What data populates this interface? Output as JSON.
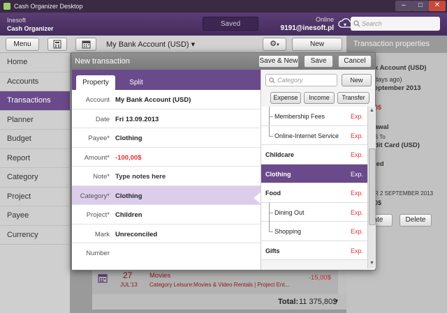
{
  "window": {
    "title": "Cash Organizer Desktop",
    "minimize": "–",
    "maximize": "□",
    "close": "✕"
  },
  "header": {
    "brand_company": "Inesoft",
    "brand_product": "Cash Organizer",
    "sync_status": "Saved",
    "online_label": "Online",
    "user_email": "9191@inesoft.pl",
    "search_placeholder": "Search"
  },
  "toolbar": {
    "menu_label": "Menu",
    "account_name": "My Bank Account (USD)",
    "new_transaction_label": "New transaction",
    "panel_title": "Transaction properties"
  },
  "sidebar": {
    "items": [
      {
        "label": "Home"
      },
      {
        "label": "Accounts"
      },
      {
        "label": "Transactions"
      },
      {
        "label": "Planner"
      },
      {
        "label": "Budget"
      },
      {
        "label": "Report"
      },
      {
        "label": "Category"
      },
      {
        "label": "Project"
      },
      {
        "label": "Payee"
      },
      {
        "label": "Currency"
      }
    ],
    "active_index": 2
  },
  "right_panel": {
    "account": "k Account (USD)",
    "days": "days ago)",
    "date": "eptember 2013",
    "amount": "0$",
    "type": "awal",
    "to_label": "S To",
    "to_account": "dit Card (USD)",
    "status": "led",
    "date2": "R 2 SEPTEMBER 2013",
    "amount2": "0$",
    "duplicate_label": "cate",
    "delete_label": "Delete"
  },
  "background_row": {
    "day": "27",
    "month": "JUL'13",
    "title": "Movies",
    "detail": "Category Leisure:Movies & Video Rentals | Project Ent...",
    "amount": "-15,00$",
    "total_label": "Total:",
    "total_value": "11 375,80$"
  },
  "dialog": {
    "title": "New transaction",
    "save_new_label": "Save & New",
    "save_label": "Save",
    "cancel_label": "Cancel",
    "tabs": [
      {
        "label": "Property"
      },
      {
        "label": "Split"
      }
    ],
    "fields": [
      {
        "label": "Account",
        "value": "My Bank Account (USD)"
      },
      {
        "label": "Date",
        "value": "Fri 13.09.2013"
      },
      {
        "label": "Payee*",
        "value": "Clothing"
      },
      {
        "label": "Amount*",
        "value": "-100,00$"
      },
      {
        "label": "Note*",
        "value": "Type notes here"
      },
      {
        "label": "Category*",
        "value": "Clothing"
      },
      {
        "label": "Project*",
        "value": "Children"
      },
      {
        "label": "Mark",
        "value": "Unreconciled"
      },
      {
        "label": "Number",
        "value": ""
      }
    ]
  },
  "category_panel": {
    "search_placeholder": "Category",
    "new_label": "New",
    "filters": [
      {
        "label": "Expense"
      },
      {
        "label": "Income"
      },
      {
        "label": "Transfer"
      }
    ],
    "items": [
      {
        "name": "Membership Fees",
        "type": "Exp."
      },
      {
        "name": "Online-Internet Service",
        "type": "Exp."
      },
      {
        "name": "Childcare",
        "type": "Exp."
      },
      {
        "name": "Clothing",
        "type": "Exp."
      },
      {
        "name": "Food",
        "type": "Exp."
      },
      {
        "name": "Dining Out",
        "type": "Exp."
      },
      {
        "name": "Shopping",
        "type": "Exp."
      },
      {
        "name": "Gifts",
        "type": "Exp."
      }
    ]
  },
  "colors": {
    "accent": "#6a4a8a",
    "header": "#4f3568",
    "negative": "#e03030"
  }
}
